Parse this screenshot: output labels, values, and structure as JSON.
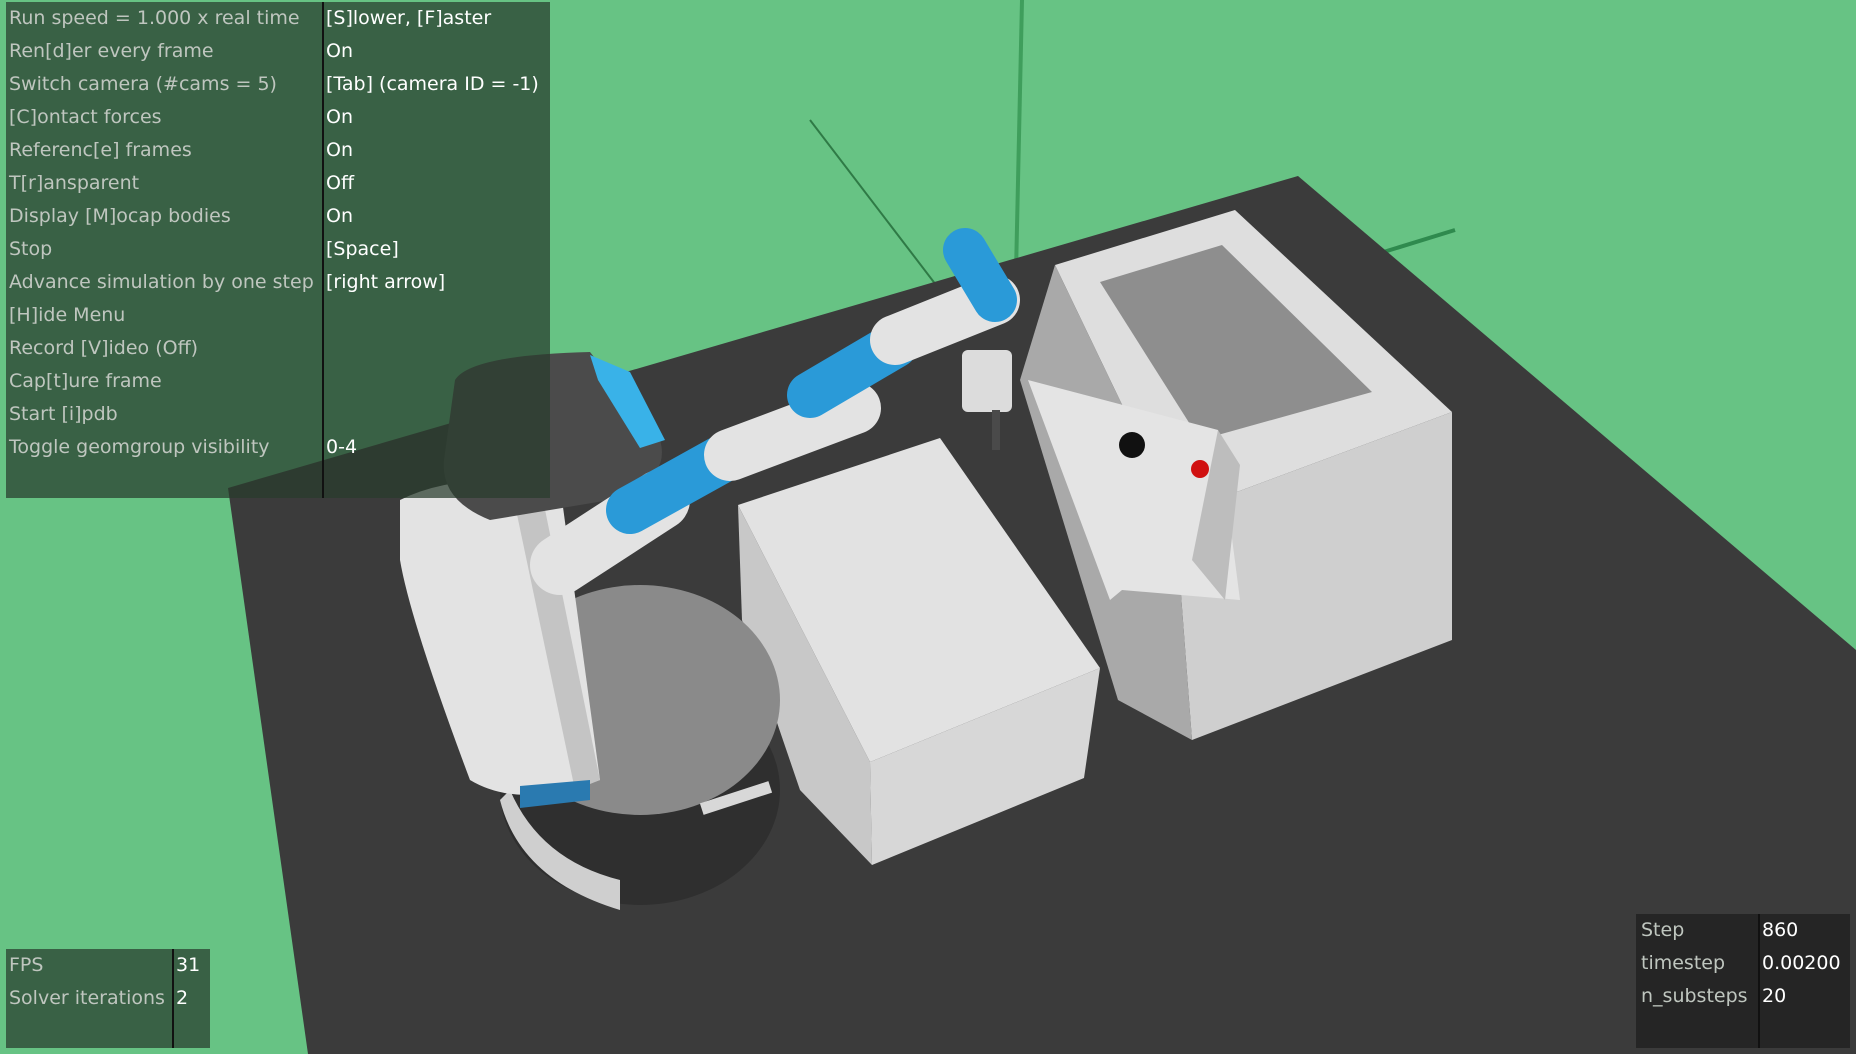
{
  "menu": [
    {
      "key": "Run speed = 1.000 x real time",
      "value": "[S]lower, [F]aster"
    },
    {
      "key": "Ren[d]er every frame",
      "value": "On"
    },
    {
      "key": "Switch camera (#cams = 5)",
      "value": "[Tab] (camera ID = -1)"
    },
    {
      "key": "[C]ontact forces",
      "value": "On"
    },
    {
      "key": "Referenc[e] frames",
      "value": "On"
    },
    {
      "key": "T[r]ansparent",
      "value": "Off"
    },
    {
      "key": "Display [M]ocap bodies",
      "value": "On"
    },
    {
      "key": "Stop",
      "value": "[Space]"
    },
    {
      "key": "Advance simulation by one step",
      "value": "[right arrow]"
    },
    {
      "key": "[H]ide Menu",
      "value": ""
    },
    {
      "key": "Record [V]ideo (Off)",
      "value": ""
    },
    {
      "key": "Cap[t]ure frame",
      "value": ""
    },
    {
      "key": "Start [i]pdb",
      "value": ""
    },
    {
      "key": "Toggle geomgroup visibility",
      "value": "0-4"
    }
  ],
  "perf": [
    {
      "key": "FPS",
      "value": "31"
    },
    {
      "key": "Solver iterations",
      "value": "2"
    }
  ],
  "sim": [
    {
      "key": "Step",
      "value": "860"
    },
    {
      "key": "timestep",
      "value": "0.00200"
    },
    {
      "key": "n_substeps",
      "value": "20"
    }
  ],
  "colors": {
    "background": "#67c384",
    "floor": "#3a3a3a",
    "robot_white": "#e6e6e6",
    "robot_blue": "#2a9ad8",
    "robot_dark": "#3c3c3c",
    "target_red": "#d01010",
    "object_black": "#111111"
  }
}
